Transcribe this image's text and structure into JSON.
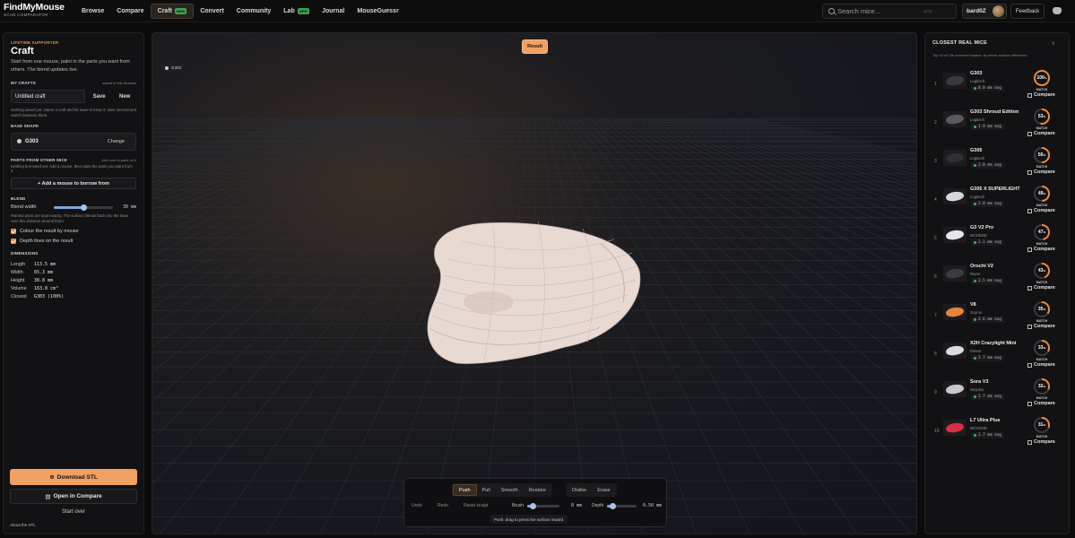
{
  "header": {
    "brand": "FindMyMouse",
    "brand_sub": "SCAN COMPARATOR",
    "nav": [
      {
        "label": "Browse",
        "active": false,
        "badge": ""
      },
      {
        "label": "Compare",
        "active": false,
        "badge": ""
      },
      {
        "label": "Craft",
        "active": true,
        "badge": "NEW"
      },
      {
        "label": "Convert",
        "active": false,
        "badge": ""
      },
      {
        "label": "Community",
        "active": false,
        "badge": ""
      },
      {
        "label": "Lab",
        "active": false,
        "badge": "NEW"
      },
      {
        "label": "Journal",
        "active": false,
        "badge": ""
      },
      {
        "label": "MouseGuessr",
        "active": false,
        "badge": ""
      }
    ],
    "search_placeholder": "Search mice...",
    "search_shortcut": "ctrl K",
    "username": "bard0Z",
    "feedback": "Feedback"
  },
  "left": {
    "supporter": "LIFETIME SUPPORTER",
    "title": "Craft",
    "description": "Start from one mouse, paint in the parts you want from others. The blend updates live.",
    "my_crafts_label": "MY CRAFTS",
    "saved_note": "saved in this browser",
    "craft_name": "Untitled craft",
    "save": "Save",
    "new": "New",
    "crafts_help": "Nothing saved yet. Name a craft and hit Save to keep it; save several and switch between them.",
    "base_shape_label": "BASE SHAPE",
    "base_shape": "G303",
    "change": "Change",
    "parts_label": "PARTS FROM OTHER MICE",
    "parts_note": "click one to paint on it",
    "parts_help": "Nothing borrowed yet. Add a mouse, then paint the parts you want from it.",
    "borrow_button": "+ Add a mouse to borrow from",
    "blend_label": "BLEND",
    "blend_width_label": "Blend width",
    "blend_width_value": "30 mm",
    "blend_width_fraction": 0.5,
    "blend_help": "Painted parts are kept exactly. The surface blends back into the base over this distance around them.",
    "colour_result": "Colour the result by mouse",
    "depth_lines": "Depth lines on the result",
    "dimensions_label": "DIMENSIONS",
    "dimensions": [
      {
        "k": "Length",
        "v": "113.5 mm"
      },
      {
        "k": "Width",
        "v": "65.3 mm"
      },
      {
        "k": "Height",
        "v": "38.8 mm"
      },
      {
        "k": "Volume",
        "v": "163.8 cm³"
      },
      {
        "k": "Closest",
        "v": "G303 (100%)"
      }
    ],
    "download": "Download STL",
    "open_compare": "Open in Compare",
    "start_over": "Start over",
    "about": "About the STL"
  },
  "viewport": {
    "result": "Result",
    "model_tag": "G303",
    "tools": [
      "Push",
      "Pull",
      "Smooth",
      "Restore"
    ],
    "active_tool": "Push",
    "tools2": [
      "Dislike",
      "Erase"
    ],
    "undo": "Undo",
    "redo": "Redo",
    "reset": "Reset sculpt",
    "brush_label": "Brush",
    "brush_value": "8 mm",
    "brush_fraction": 0.18,
    "depth_label": "Depth",
    "depth_value": "0.50 mm",
    "depth_fraction": 0.2,
    "hint": "Push: drag to press the surface inward."
  },
  "right": {
    "title": "CLOSEST REAL MICE",
    "subtitle": "Top 10 of 136 scanned shapes, by whole-surface difference",
    "match_label": "MATCH",
    "compare_label": "Compare",
    "mice": [
      {
        "rank": "1",
        "name": "G303",
        "brand": "Logitech",
        "dev": "0.0 mm avg",
        "match": 100,
        "color": "#3a3a3d"
      },
      {
        "rank": "2",
        "name": "G303 Shroud Edition",
        "brand": "Logitech",
        "dev": "1.9 mm avg",
        "match": 53,
        "color": "#5a5a5e"
      },
      {
        "rank": "3",
        "name": "G305",
        "brand": "Logitech",
        "dev": "2.0 mm avg",
        "match": 50,
        "color": "#2f2f32"
      },
      {
        "rank": "4",
        "name": "G305 X SUPERLIGHT",
        "brand": "Logitech",
        "dev": "2.0 mm avg",
        "match": 49,
        "color": "#d8d8dc"
      },
      {
        "rank": "5",
        "name": "G3 V2 Pro",
        "brand": "MCHOSE",
        "dev": "2.1 mm avg",
        "match": 47,
        "color": "#e6e6ea"
      },
      {
        "rank": "6",
        "name": "Orochi V2",
        "brand": "Razer",
        "dev": "2.5 mm avg",
        "match": 43,
        "color": "#3c3c40"
      },
      {
        "rank": "7",
        "name": "V8",
        "brand": "Scyrox",
        "dev": "2.6 mm avg",
        "match": 35,
        "color": "#e8843a"
      },
      {
        "rank": "8",
        "name": "X2H Crazylight Mini",
        "brand": "Pulsar",
        "dev": "2.7 mm avg",
        "match": 33,
        "color": "#dcdce0"
      },
      {
        "rank": "9",
        "name": "Sora V3",
        "brand": "Ninjutso",
        "dev": "2.7 mm avg",
        "match": 32,
        "color": "#c8c8cc"
      },
      {
        "rank": "10",
        "name": "L7 Ultra Plus",
        "brand": "MCHOSE",
        "dev": "2.7 mm avg",
        "match": 31,
        "color": "#d8304a"
      }
    ]
  }
}
